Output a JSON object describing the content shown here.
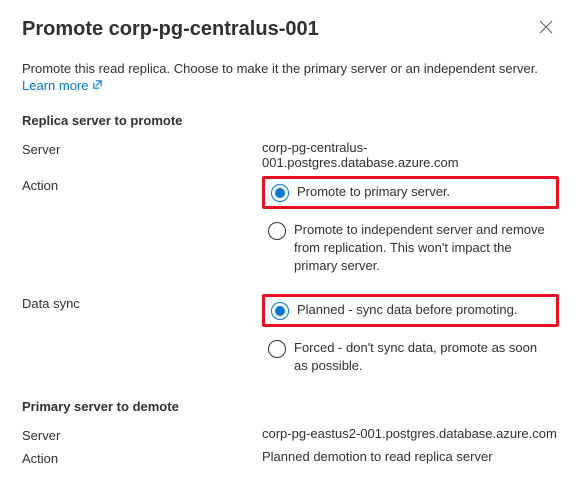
{
  "header": {
    "title": "Promote corp-pg-centralus-001"
  },
  "intro": {
    "text": "Promote this read replica. Choose to make it the primary server or an independent server.",
    "learn_more": "Learn more"
  },
  "replica_section": {
    "heading": "Replica server to promote",
    "server_label": "Server",
    "server_value": "corp-pg-centralus-001.postgres.database.azure.com",
    "action_label": "Action",
    "action_options": {
      "promote_primary": "Promote to primary server.",
      "promote_independent": "Promote to independent server and remove from replication. This won't impact the primary server."
    },
    "datasync_label": "Data sync",
    "datasync_options": {
      "planned": "Planned - sync data before promoting.",
      "forced": "Forced - don't sync data, promote as soon as possible."
    }
  },
  "primary_section": {
    "heading": "Primary server to demote",
    "server_label": "Server",
    "server_value": "corp-pg-eastus2-001.postgres.database.azure.com",
    "action_label": "Action",
    "action_value": "Planned demotion to read replica server"
  }
}
